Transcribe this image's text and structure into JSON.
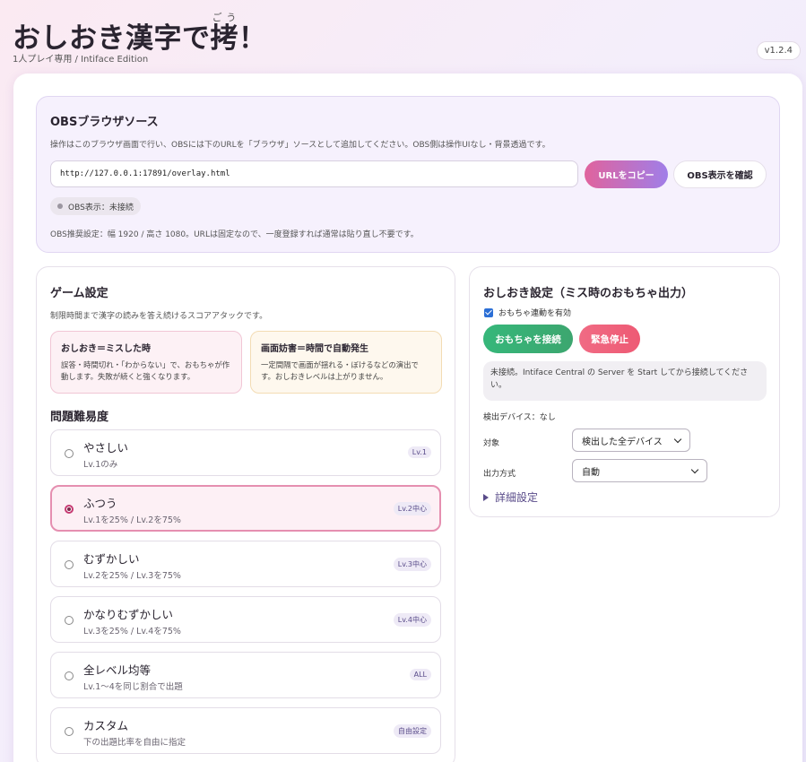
{
  "app": {
    "title": "おしおき漢字で拷！",
    "title_main": "おしおき漢字で",
    "title_kanji": "拷",
    "title_ruby": "ごう",
    "title_end": "！",
    "subtitle": "1人プレイ専用 / Intiface Edition",
    "version": "v1.2.4"
  },
  "obs": {
    "title": "OBSブラウザソース",
    "description": "操作はこのブラウザ画面で行い、OBSには下のURLを「ブラウザ」ソースとして追加してください。OBS側は操作UIなし・背景透過です。",
    "url_value": "http://127.0.0.1:17891/overlay.html",
    "copy_button": "URLをコピー",
    "check_button": "OBS表示を確認",
    "status": "OBS表示：未接続",
    "note": "OBS推奨設定：幅 1920 / 高さ 1080。URLは固定なので、一度登録すれば通常は貼り直し不要です。"
  },
  "game": {
    "title": "ゲーム設定",
    "description": "制限時間まで漢字の読みを答え続けるスコアアタックです。",
    "info_punish": {
      "heading": "おしおき＝ミスした時",
      "body": "誤答・時間切れ・「わからない」で、おもちゃが作動します。失敗が続くと強くなります。"
    },
    "info_disturb": {
      "heading": "画面妨害＝時間で自動発生",
      "body": "一定間隔で画面が揺れる・ぼけるなどの演出です。おしおきレベルは上がりません。"
    },
    "difficulty_heading": "問題難易度",
    "difficulties": [
      {
        "name": "やさしい",
        "sub": "Lv.1のみ",
        "badge": "Lv.1",
        "selected": false
      },
      {
        "name": "ふつう",
        "sub": "Lv.1を25% / Lv.2を75%",
        "badge": "Lv.2中心",
        "selected": true
      },
      {
        "name": "むずかしい",
        "sub": "Lv.2を25% / Lv.3を75%",
        "badge": "Lv.3中心",
        "selected": false
      },
      {
        "name": "かなりむずかしい",
        "sub": "Lv.3を25% / Lv.4を75%",
        "badge": "Lv.4中心",
        "selected": false
      },
      {
        "name": "全レベル均等",
        "sub": "Lv.1〜4を同じ割合で出題",
        "badge": "ALL",
        "selected": false
      },
      {
        "name": "カスタム",
        "sub": "下の出題比率を自由に指定",
        "badge": "自由設定",
        "selected": false
      }
    ]
  },
  "punish": {
    "title": "おしおき設定（ミス時のおもちゃ出力）",
    "toy_link_label": "おもちゃ連動を有効",
    "toy_link_checked": true,
    "connect_button": "おもちゃを接続",
    "stop_button": "緊急停止",
    "connection_message": "未接続。Intiface Central の Server を Start してから接続してください。",
    "detected": "検出デバイス：なし",
    "target_label": "対象",
    "target_value": "検出した全デバイス",
    "output_label": "出力方式",
    "output_value": "自動",
    "advanced_label": "詳細設定"
  },
  "colors": {
    "accent_pink": "#e0639d",
    "accent_purple": "#a07ee8",
    "connect_green": "#36b77a",
    "stop_red": "#f06b84",
    "selected_border": "#e58fb0"
  }
}
